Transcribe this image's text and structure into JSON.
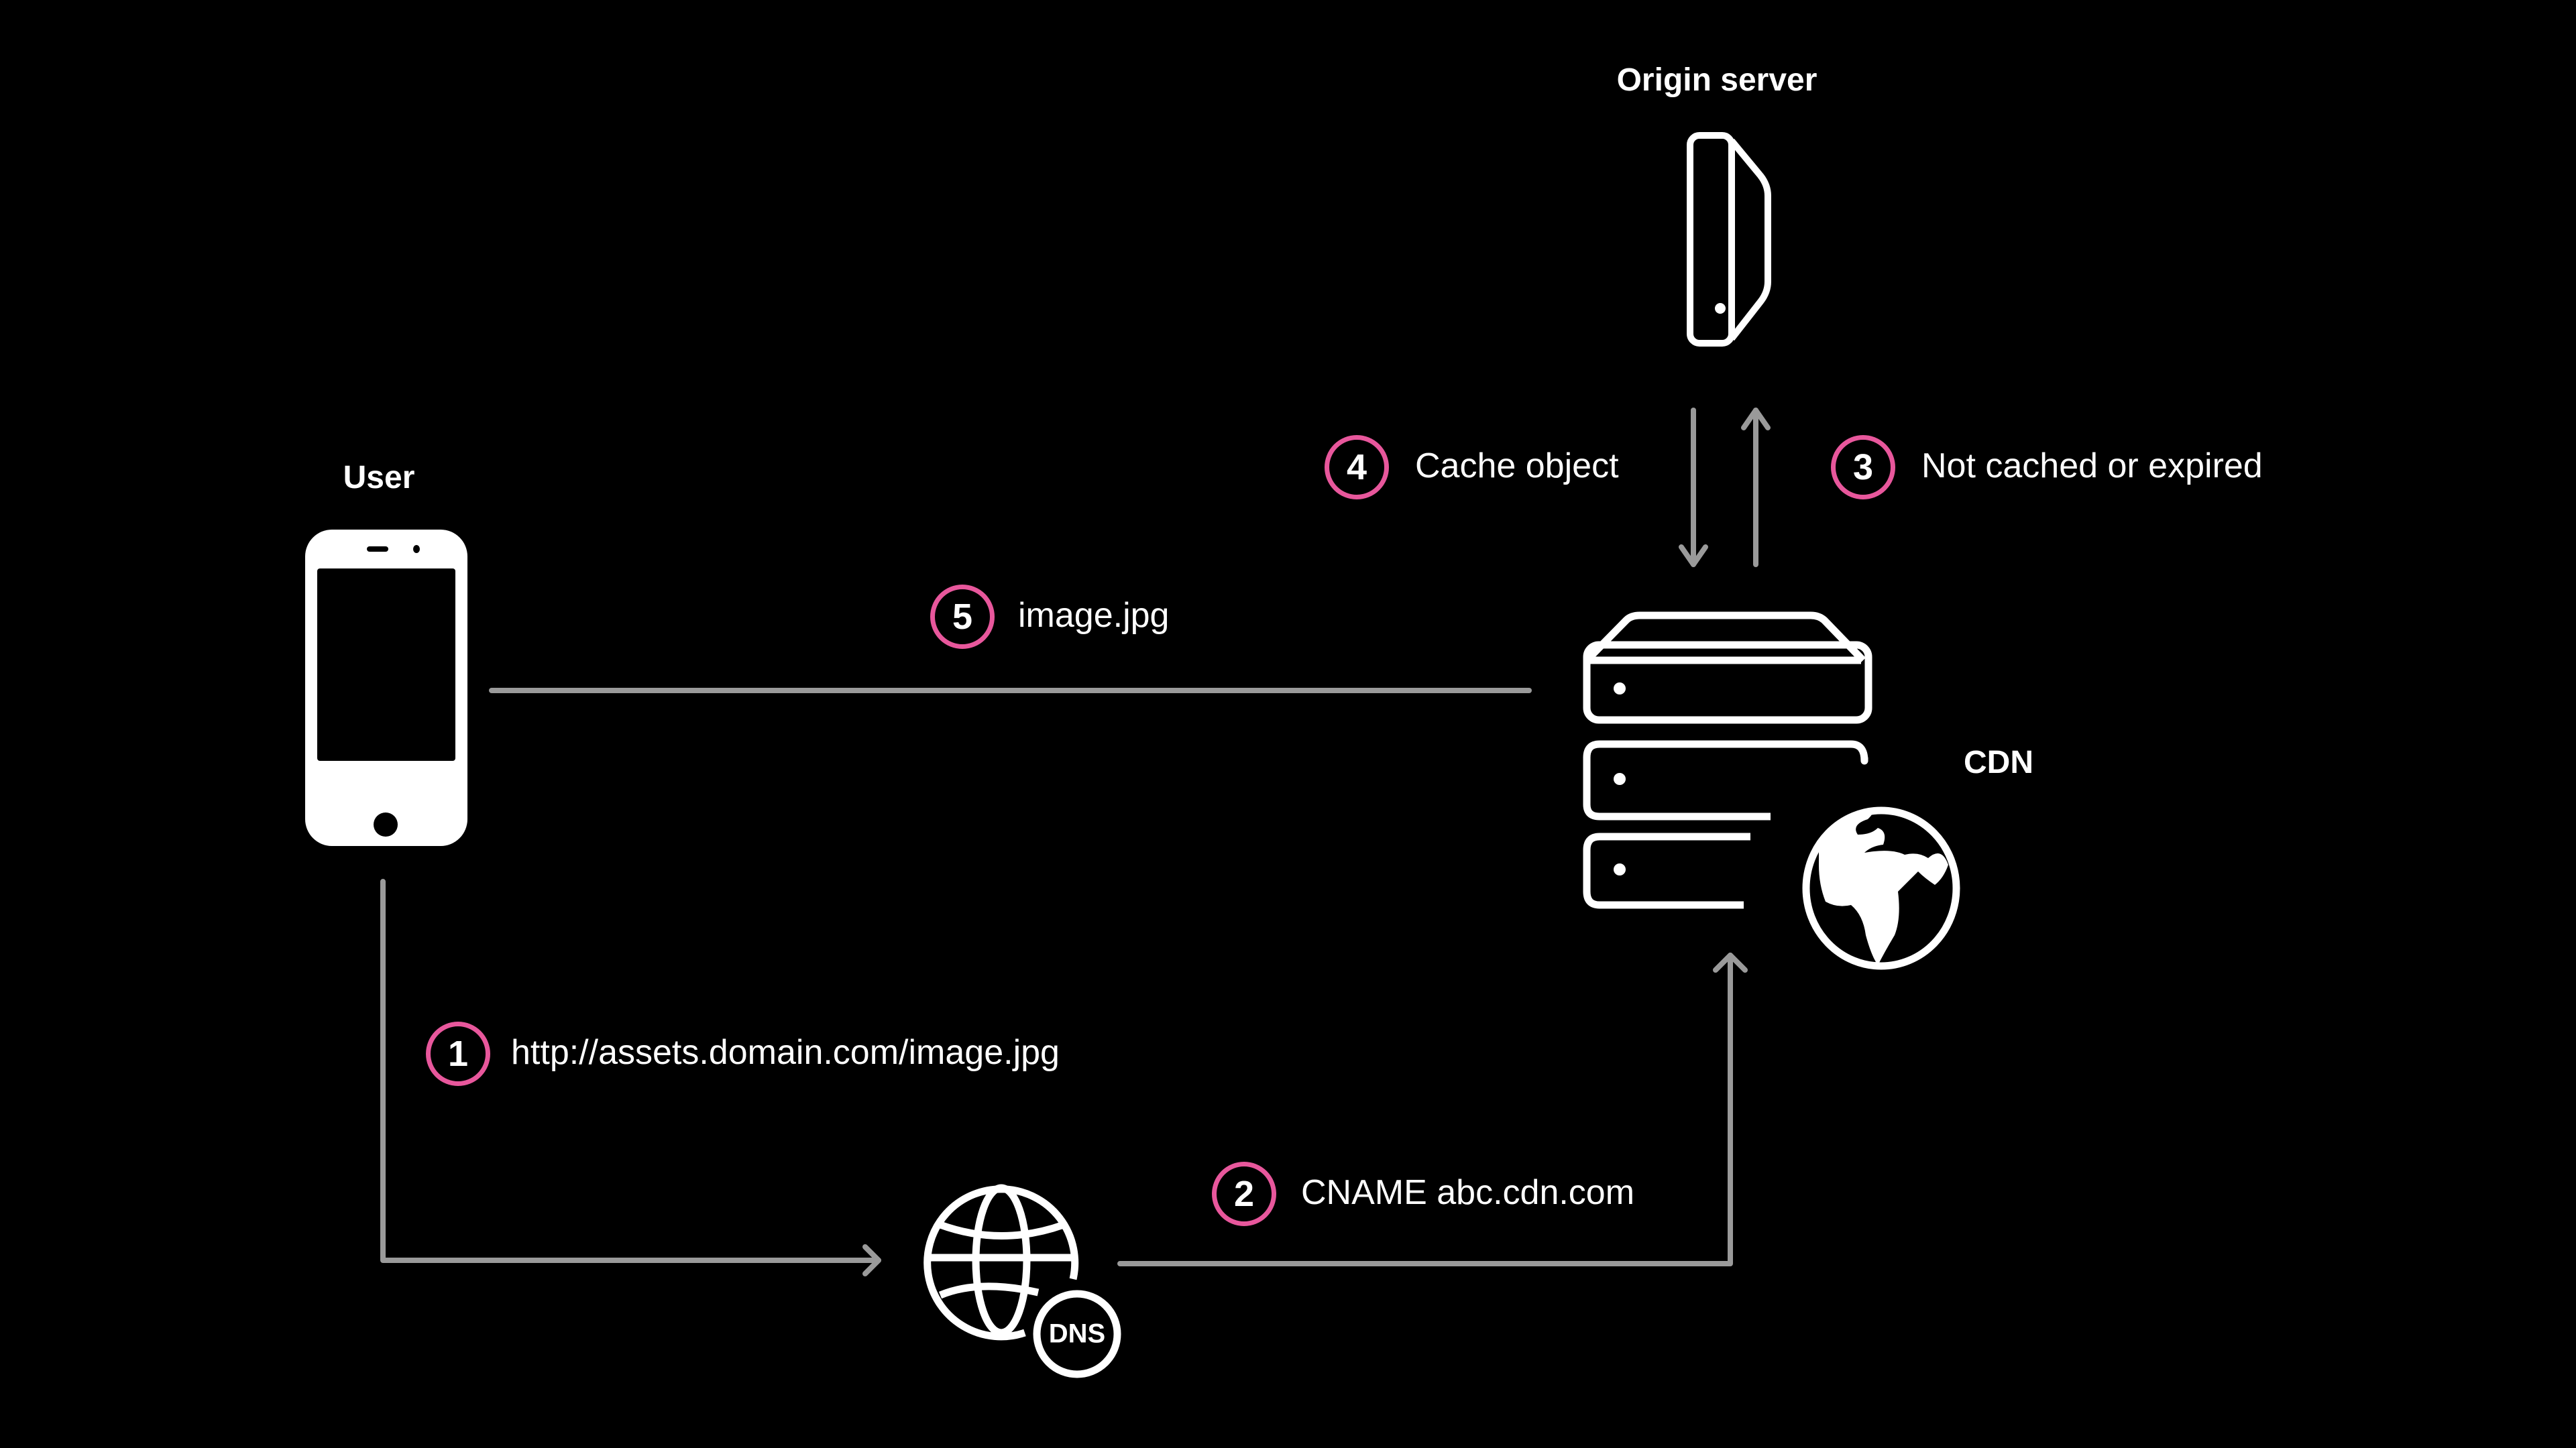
{
  "colors": {
    "background": "#000000",
    "icon": "#ffffff",
    "connector": "#9a9a9a",
    "badge_ring": "#e8579c"
  },
  "nodes": {
    "user": {
      "label": "User",
      "icon": "smartphone-icon"
    },
    "origin": {
      "label": "Origin server",
      "icon": "server-tower-icon"
    },
    "cdn": {
      "label": "CDN",
      "icon": "server-stack-globe-icon"
    },
    "dns": {
      "badge": "DNS",
      "icon": "globe-dns-icon"
    }
  },
  "steps": [
    {
      "number": "1",
      "text": "http://assets.domain.com/image.jpg",
      "from": "user",
      "to": "dns"
    },
    {
      "number": "2",
      "text": "CNAME abc.cdn.com",
      "from": "dns",
      "to": "cdn"
    },
    {
      "number": "3",
      "text": "Not cached or expired",
      "from": "cdn",
      "to": "origin"
    },
    {
      "number": "4",
      "text": "Cache object",
      "from": "origin",
      "to": "cdn"
    },
    {
      "number": "5",
      "text": "image.jpg",
      "from": "cdn",
      "to": "user"
    }
  ]
}
